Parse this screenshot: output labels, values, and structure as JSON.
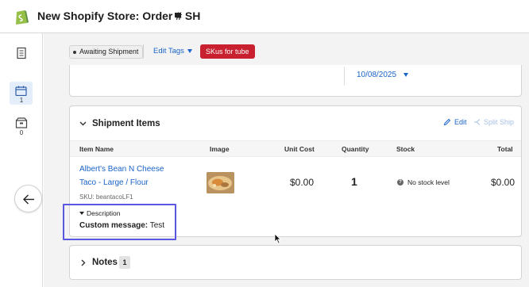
{
  "window": {
    "title": "New Shopify Store:  Order # SH"
  },
  "rail": {
    "items": [
      {
        "icon": "document-icon",
        "count": ""
      },
      {
        "icon": "calendar-icon",
        "count": "1"
      },
      {
        "icon": "package-icon",
        "count": "0"
      }
    ]
  },
  "header": {
    "status_tag": "Awaiting Shipment",
    "edit_tags_label": "Edit Tags",
    "sku_tag": "SKus for tube"
  },
  "dates": {
    "ship_date": "10/08/2025"
  },
  "shipment": {
    "title": "Shipment Items",
    "edit_label": "Edit",
    "split_label": "Split Ship",
    "columns": [
      "Item Name",
      "Image",
      "Unit Cost",
      "Quantity",
      "Stock",
      "Total"
    ],
    "item": {
      "name_line1": "Albert's Bean N Cheese",
      "name_line2": "Taco - Large / Flour",
      "sku": "SKU: beantacoLF1",
      "unit_cost": "$0.00",
      "quantity": "1",
      "stock": "No stock level",
      "total": "$0.00",
      "description_label": "Description",
      "custom_message_label": "Custom message:",
      "custom_message_value": "Test"
    }
  },
  "notes": {
    "title": "Notes",
    "count": "1"
  },
  "colors": {
    "link": "#1a63c8",
    "sku_tag_bg": "#c8202e",
    "highlight": "#5a57e0",
    "rail_active": "#e4eefb"
  }
}
